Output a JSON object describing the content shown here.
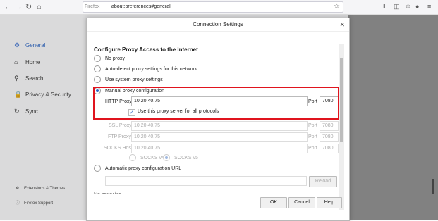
{
  "browser": {
    "brand": "Firefox",
    "url": "about:preferences#general"
  },
  "sidebar": {
    "items": [
      {
        "label": "General",
        "icon": "gear-icon"
      },
      {
        "label": "Home",
        "icon": "home-icon"
      },
      {
        "label": "Search",
        "icon": "search-icon"
      },
      {
        "label": "Privacy & Security",
        "icon": "lock-icon"
      },
      {
        "label": "Sync",
        "icon": "sync-icon"
      }
    ],
    "footer": [
      {
        "label": "Extensions & Themes",
        "icon": "puzzle-icon"
      },
      {
        "label": "Firefox Support",
        "icon": "help-icon"
      }
    ]
  },
  "dialog": {
    "title": "Connection Settings",
    "heading": "Configure Proxy Access to the Internet",
    "options": {
      "no_proxy": "No proxy",
      "auto_detect": "Auto-detect proxy settings for this network",
      "system": "Use system proxy settings",
      "manual": "Manual proxy configuration",
      "auto_url": "Automatic proxy configuration URL"
    },
    "http_label": "HTTP Proxy",
    "http_value": "10.20.40.75",
    "port_label": "Port",
    "http_port": "7080",
    "use_for_all": "Use this proxy server for all protocols",
    "ssl_label": "SSL Proxy",
    "ssl_value": "10.20.40.75",
    "ssl_port": "7080",
    "ftp_label": "FTP Proxy",
    "ftp_value": "10.20.40.75",
    "ftp_port": "7080",
    "socks_label": "SOCKS Host",
    "socks_value": "10.20.40.75",
    "socks_port": "7080",
    "socks_v4": "SOCKS v4",
    "socks_v5": "SOCKS v5",
    "reload": "Reload",
    "cutoff": "No proxy for",
    "ok": "OK",
    "cancel": "Cancel",
    "help": "Help"
  },
  "colors": {
    "accent": "#2a64c4",
    "highlight_border": "#e0141e"
  }
}
